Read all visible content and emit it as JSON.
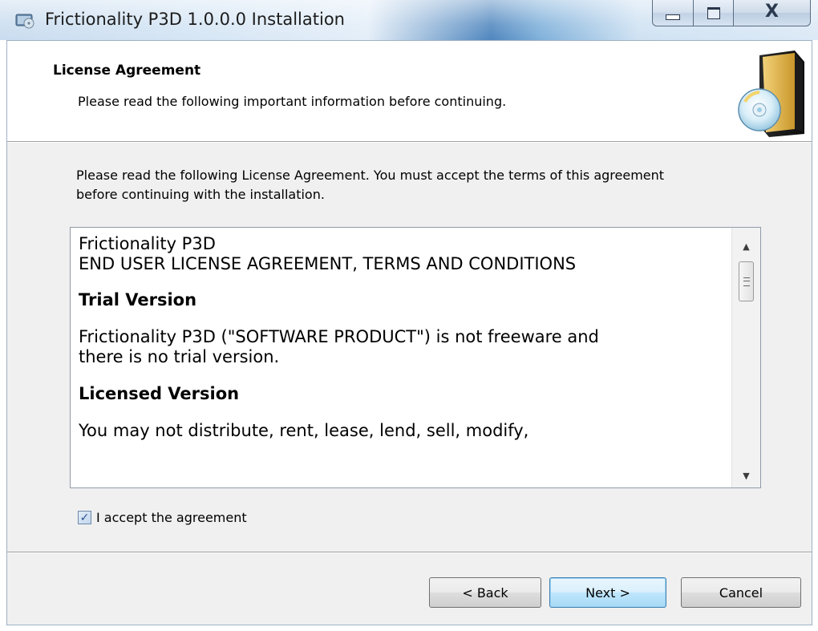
{
  "window": {
    "title": "Frictionality P3D 1.0.0.0 Installation",
    "caption_minimize": "",
    "caption_maximize": "",
    "caption_close": "X"
  },
  "header": {
    "title": "License Agreement",
    "subtitle": "Please read the following important information before continuing."
  },
  "intro": {
    "text": "Please read the following License Agreement. You must accept the terms of this agreement before continuing with the installation."
  },
  "license": {
    "line1": "Frictionality P3D",
    "line2": "END USER LICENSE AGREEMENT, TERMS AND CONDITIONS",
    "heading_trial": "Trial Version",
    "trial_line1": "Frictionality P3D (\"SOFTWARE PRODUCT\") is not freeware and",
    "trial_line2": "there is no trial version.",
    "heading_licensed": "Licensed Version",
    "licensed_line1": "You may not distribute, rent, lease, lend, sell, modify,"
  },
  "accept": {
    "label": "I accept the agreement",
    "checked": true
  },
  "buttons": {
    "back": "< Back",
    "next": "Next >",
    "cancel": "Cancel"
  },
  "colors": {
    "accent_button_border": "#3c7fb1",
    "checkmark": "#2a4f8f"
  },
  "icons": {
    "app": "installer-app-icon",
    "header": "install-disc-book-icon"
  }
}
